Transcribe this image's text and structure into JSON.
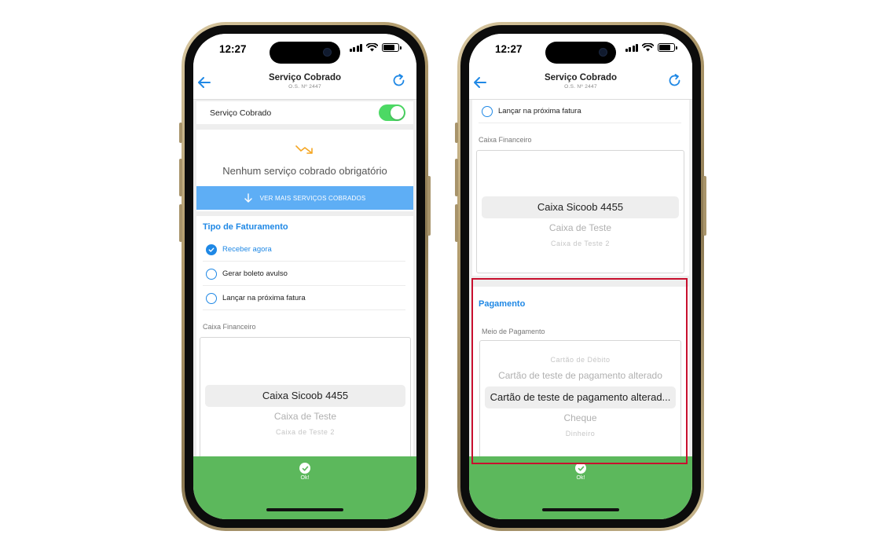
{
  "status": {
    "time": "12:27"
  },
  "nav": {
    "title": "Serviço Cobrado",
    "subtitle": "O.S. Nº 2447"
  },
  "left": {
    "toggle_row": {
      "label": "Serviço Cobrado",
      "enabled": true
    },
    "empty_state": {
      "message": "Nenhum serviço cobrado obrigatório",
      "button_label": "VER MAIS SERVIÇOS COBRADOS"
    },
    "billing": {
      "title": "Tipo de Faturamento",
      "options": [
        {
          "label": "Receber agora",
          "selected": true
        },
        {
          "label": "Gerar boleto avulso",
          "selected": false
        },
        {
          "label": "Lançar na próxima fatura",
          "selected": false
        }
      ]
    },
    "cash": {
      "label": "Caixa Financeiro",
      "selected": "Caixa Sicoob 4455",
      "below": [
        "Caixa de Teste",
        "Caixa de Teste 2"
      ]
    }
  },
  "right": {
    "option": {
      "label": "Lançar na próxima fatura",
      "selected": false
    },
    "cash": {
      "label": "Caixa Financeiro",
      "selected": "Caixa Sicoob 4455",
      "below": [
        "Caixa de Teste",
        "Caixa de Teste 2"
      ]
    },
    "payment": {
      "title": "Pagamento",
      "label": "Meio de Pagamento",
      "above": [
        "Cartão de Débito",
        "Cartão de teste de pagamento alterado"
      ],
      "selected": "Cartão de teste de pagamento alterad...",
      "below": [
        "Cheque",
        "Dinheiro"
      ]
    }
  },
  "ok": {
    "label": "Ok!"
  },
  "colors": {
    "accent": "#1f88e5",
    "toggle_on": "#4cd964",
    "ok_bar": "#5cb85c",
    "blue_button": "#5eaef5",
    "highlight": "#c8102e"
  },
  "icons": {
    "back": "arrow-left-icon",
    "refresh": "refresh-icon",
    "empty": "trend-down-icon",
    "button": "arrow-down-icon",
    "check": "check-icon",
    "ok": "check-circle-icon"
  }
}
